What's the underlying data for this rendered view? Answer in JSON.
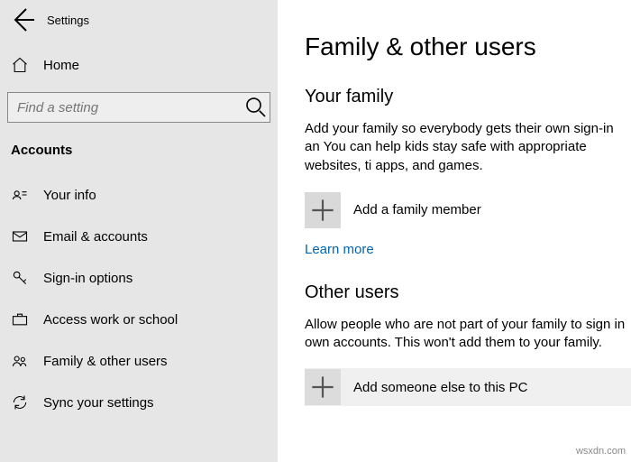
{
  "topbar": {
    "title": "Settings"
  },
  "home": {
    "label": "Home"
  },
  "search": {
    "placeholder": "Find a setting"
  },
  "section": "Accounts",
  "nav": {
    "items": [
      {
        "label": "Your info"
      },
      {
        "label": "Email & accounts"
      },
      {
        "label": "Sign-in options"
      },
      {
        "label": "Access work or school"
      },
      {
        "label": "Family & other users"
      },
      {
        "label": "Sync your settings"
      }
    ]
  },
  "page": {
    "title": "Family & other users",
    "family": {
      "heading": "Your family",
      "desc": "Add your family so everybody gets their own sign-in an You can help kids stay safe with appropriate websites, ti apps, and games.",
      "add_label": "Add a family member",
      "learn_more": "Learn more"
    },
    "others": {
      "heading": "Other users",
      "desc": "Allow people who are not part of your family to sign in own accounts. This won't add them to your family.",
      "add_label": "Add someone else to this PC"
    }
  },
  "watermark": "wsxdn.com"
}
